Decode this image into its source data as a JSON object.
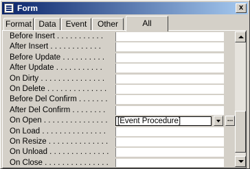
{
  "window": {
    "title": "Form",
    "close_glyph": "x"
  },
  "tabs": [
    "Format",
    "Data",
    "Event",
    "Other",
    "All"
  ],
  "active_tab": "All",
  "properties": [
    {
      "label": "Before Insert . . . . . . . . . . .",
      "value": ""
    },
    {
      "label": "After Insert . . . . . . . . . . . .",
      "value": ""
    },
    {
      "label": "Before Update . . . . . . . . . .",
      "value": ""
    },
    {
      "label": "After Update . . . . . . . . . . .",
      "value": ""
    },
    {
      "label": "On Dirty . . . . . . . . . . . . . . .",
      "value": ""
    },
    {
      "label": "On Delete . . . . . . . . . . . . . .",
      "value": ""
    },
    {
      "label": "Before Del Confirm . . . . . . .",
      "value": ""
    },
    {
      "label": "After Del Confirm . . . . . . . .",
      "value": ""
    },
    {
      "label": "On Open . . . . . . . . . . . . . . .",
      "value": "[Event Procedure]"
    },
    {
      "label": "On Load . . . . . . . . . . . . . . .",
      "value": ""
    },
    {
      "label": "On Resize . . . . . . . . . . . . . .",
      "value": ""
    },
    {
      "label": "On Unload . . . . . . . . . . . . . .",
      "value": ""
    },
    {
      "label": "On Close . . . . . . . . . . . . . . .",
      "value": ""
    }
  ],
  "build_button_label": "..."
}
